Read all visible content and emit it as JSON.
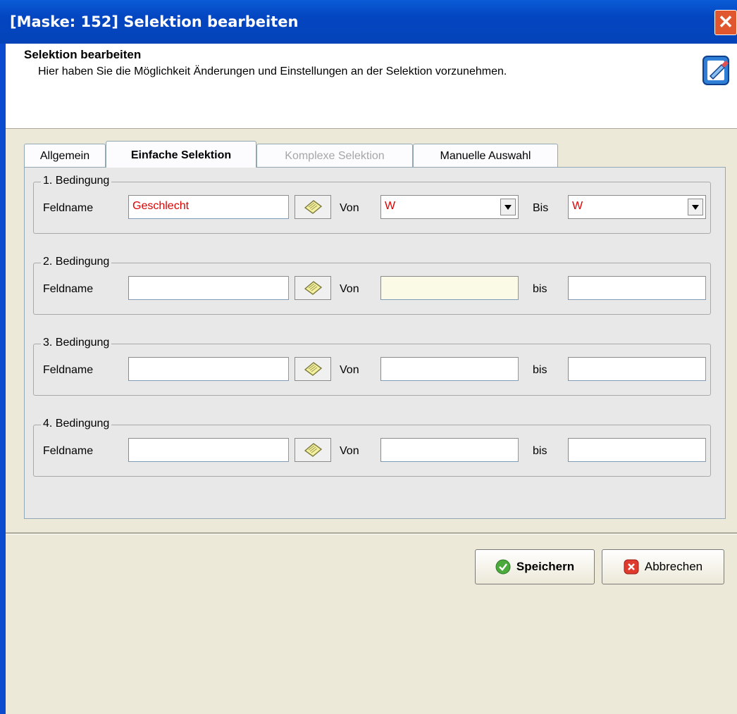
{
  "window": {
    "title": "[Maske: 152] Selektion bearbeiten",
    "close_glyph": "✕"
  },
  "header": {
    "title": "Selektion bearbeiten",
    "description": "Hier haben Sie die Möglichkeit Änderungen und Einstellungen an der Selektion vorzunehmen.",
    "icon": "edit-document-icon"
  },
  "tabs": [
    {
      "label": "Allgemein",
      "state": "normal"
    },
    {
      "label": "Einfache Selektion",
      "state": "active"
    },
    {
      "label": "Komplexe Selektion",
      "state": "disabled"
    },
    {
      "label": "Manuelle Auswahl",
      "state": "normal"
    }
  ],
  "conditions": [
    {
      "legend": "1. Bedingung",
      "field_label": "Feldname",
      "field_value": "Geschlecht",
      "from_label": "Von",
      "from_value": "W",
      "to_label": "Bis",
      "to_value": "W"
    },
    {
      "legend": "2. Bedingung",
      "field_label": "Feldname",
      "field_value": "",
      "from_label": "Von",
      "from_value": "",
      "to_label": "bis",
      "to_value": ""
    },
    {
      "legend": "3. Bedingung",
      "field_label": "Feldname",
      "field_value": "",
      "from_label": "Von",
      "from_value": "",
      "to_label": "bis",
      "to_value": ""
    },
    {
      "legend": "4. Bedingung",
      "field_label": "Feldname",
      "field_value": "",
      "from_label": "Von",
      "from_value": "",
      "to_label": "bis",
      "to_value": ""
    }
  ],
  "buttons": {
    "save": "Speichern",
    "cancel": "Abbrechen"
  },
  "colors": {
    "titlebar": "#0445c0",
    "highlight_text": "#e00000",
    "focused_field": "#fafae6"
  }
}
